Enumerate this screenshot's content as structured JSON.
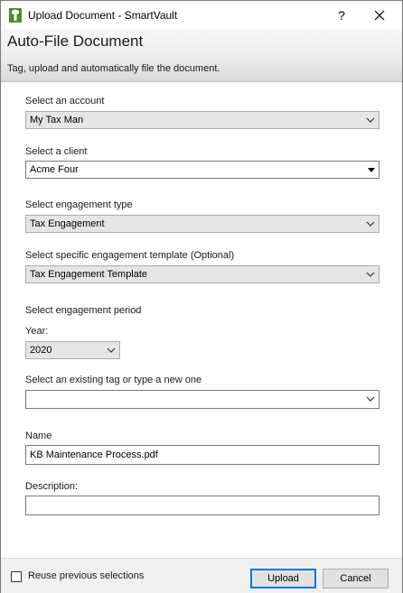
{
  "window": {
    "title": "Upload Document - SmartVault",
    "help_label": "?",
    "close_icon": "close-icon",
    "app_icon": "smartvault-logo-icon"
  },
  "header": {
    "title": "Auto-File Document",
    "subtitle": "Tag, upload and automatically file the document."
  },
  "form": {
    "account": {
      "label": "Select an account",
      "value": "My Tax Man"
    },
    "client": {
      "label": "Select a client",
      "value": "Acme Four"
    },
    "engagement_type": {
      "label": "Select engagement type",
      "value": "Tax Engagement"
    },
    "engagement_template": {
      "label": "Select specific engagement template (Optional)",
      "value": "Tax Engagement Template"
    },
    "engagement_period": {
      "label": "Select engagement period",
      "year_label": "Year:",
      "year_value": "2020"
    },
    "tag": {
      "label": "Select an existing tag or type a new one",
      "value": ""
    },
    "name": {
      "label": "Name",
      "value": "KB Maintenance Process.pdf"
    },
    "description": {
      "label": "Description:",
      "value": ""
    }
  },
  "footer": {
    "reuse_label": "Reuse previous selections",
    "reuse_checked": false,
    "upload_label": "Upload",
    "cancel_label": "Cancel"
  },
  "colors": {
    "accent": "#0078d7",
    "header_gradient_top": "#f7f7f7",
    "header_gradient_bottom": "#d9d9d9",
    "combo_bg": "#e5e5e5",
    "app_icon_green": "#4a8c2a"
  }
}
